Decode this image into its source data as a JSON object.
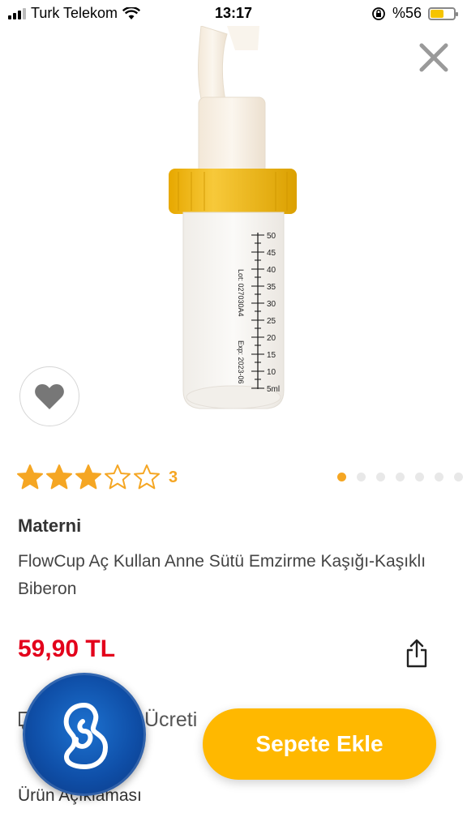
{
  "status_bar": {
    "carrier": "Turk Telekom",
    "time": "13:17",
    "battery": "%56",
    "battery_level": 0.56
  },
  "product": {
    "rating_count": "3",
    "rating_value": 3,
    "rating_max": 5,
    "brand": "Materni",
    "title": "FlowCup Aç Kullan Anne Sütü Emzirme Kaşığı-Kaşıklı Biberon",
    "price": "59,90 TL",
    "image_count": 7,
    "active_image": 0,
    "bottle_label": {
      "lot": "Lot: 027030A4",
      "exp": "Exp: 2023-06",
      "scale": [
        "50",
        "45",
        "40",
        "35",
        "30",
        "25",
        "20",
        "15",
        "10",
        "5ml"
      ]
    }
  },
  "shipping": {
    "label": "Ücreti"
  },
  "actions": {
    "add_to_cart": "Sepete Ekle"
  },
  "sections": {
    "description_heading": "Ürün Açıklaması"
  },
  "colors": {
    "accent": "#ffb800",
    "star": "#f5a623",
    "price": "#e3001b",
    "cap": "#f2b705"
  }
}
